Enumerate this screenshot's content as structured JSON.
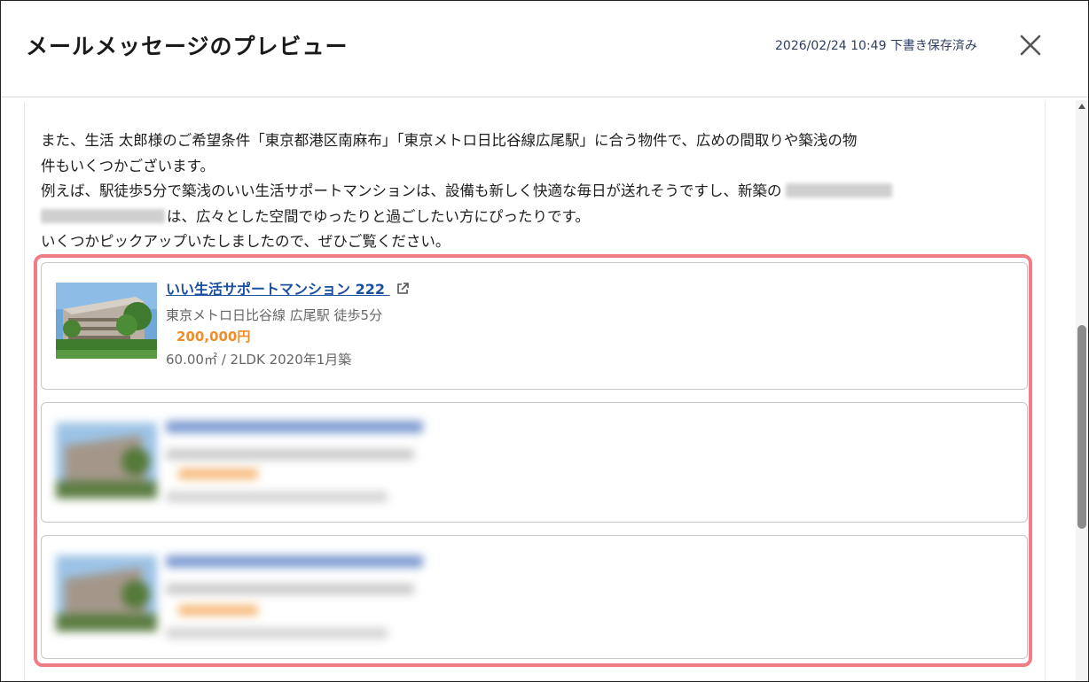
{
  "dialog": {
    "title": "メールメッセージのプレビュー",
    "saved_status": "2026/02/24 10:49 下書き保存済み"
  },
  "message": {
    "line1": "また、生活 太郎様のご希望条件「東京都港区南麻布」「東京メトロ日比谷線広尾駅」に合う物件で、広めの間取りや築浅の物",
    "line2": "件もいくつかございます。",
    "line3_prefix": "例えば、駅徒歩5分で築浅のいい生活サポートマンションは、設備も新しく快適な毎日が送れそうですし、新築の",
    "line4_suffix": "は、広々とした空間でゆったりと過ごしたい方にぴったりです。",
    "line5": "いくつかピックアップいたしましたので、ぜひご覧ください。"
  },
  "properties": [
    {
      "name": "いい生活サポートマンション 222",
      "access": "東京メトロ日比谷線 広尾駅 徒歩5分",
      "price": "200,000円",
      "spec": "60.00㎡ / 2LDK  2020年1月築"
    }
  ],
  "icons": {
    "close": "close-icon",
    "external_link": "external-link-icon",
    "scroll_up": "scroll-up-arrow-icon"
  },
  "colors": {
    "highlight_border": "#f07c85",
    "link": "#1b4fa0",
    "price": "#f28c28",
    "saved_text": "#2d3e63"
  }
}
